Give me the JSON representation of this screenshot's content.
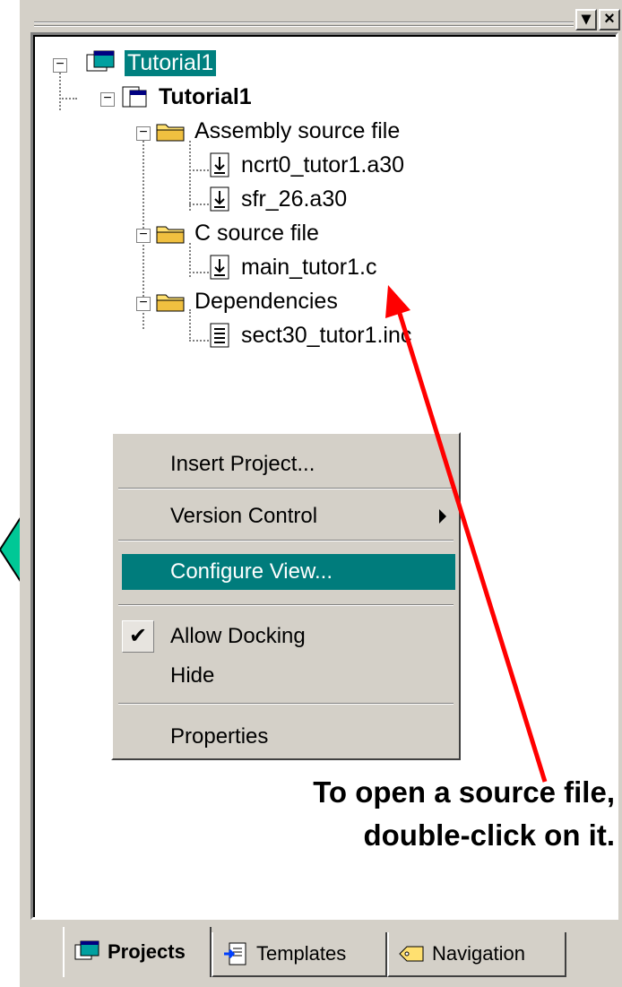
{
  "window": {
    "minimize_glyph": "▾",
    "close_glyph": "×"
  },
  "tree": {
    "root_label": "Tutorial1",
    "project_label": "Tutorial1",
    "folders": [
      {
        "label": "Assembly source file",
        "files": [
          "ncrt0_tutor1.a30",
          "sfr_26.a30"
        ]
      },
      {
        "label": "C source file",
        "files": [
          "main_tutor1.c"
        ]
      },
      {
        "label": "Dependencies",
        "files": [
          "sect30_tutor1.inc"
        ]
      }
    ]
  },
  "context_menu": {
    "items": [
      {
        "label": "Insert Project..."
      },
      {
        "label": "Version Control"
      },
      {
        "label": "Configure View..."
      },
      {
        "label": "Allow Docking",
        "checked": true
      },
      {
        "label": "Hide"
      },
      {
        "label": "Properties"
      }
    ]
  },
  "tabs": [
    {
      "label": "Projects",
      "active": true
    },
    {
      "label": "Templates",
      "active": false
    },
    {
      "label": "Navigation",
      "active": false
    }
  ],
  "annotation": {
    "line1": "To open a source file,",
    "line2": "double-click on it."
  },
  "colors": {
    "selection": "#007c7c",
    "arrow_red": "#ff0000",
    "big_arrow": "#00c896"
  }
}
